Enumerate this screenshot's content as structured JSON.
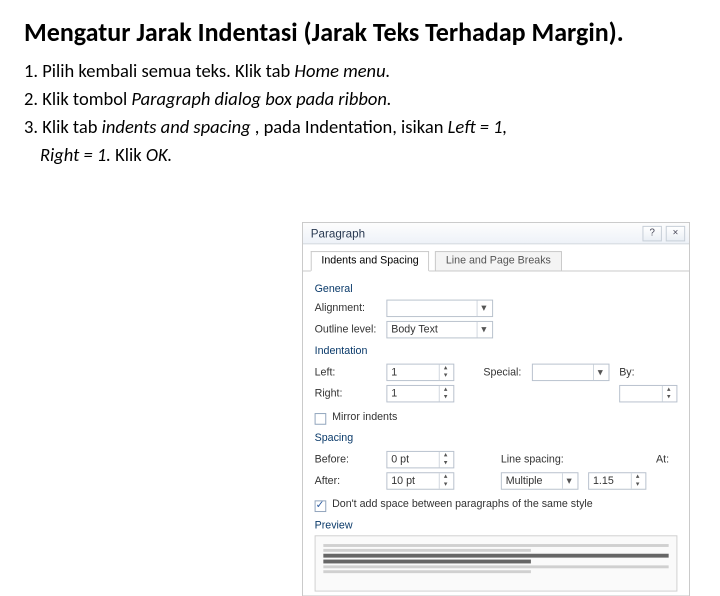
{
  "title": "Mengatur Jarak Indentasi (Jarak Teks Terhadap Margin).",
  "steps": {
    "s1a": "1. Pilih kembali semua teks. Klik tab ",
    "s1b": "Home menu.",
    "s2a": "2. Klik tombol ",
    "s2b": "Paragraph dialog box pada ribbon.",
    "s3a": "3. Klik tab ",
    "s3b": "indents and spacing ",
    "s3c": ", pada Indentation, isikan ",
    "s3d": "Left = 1,",
    "s3e": "Right = 1. ",
    "s3f": "Klik ",
    "s3g": "OK."
  },
  "dialog": {
    "title": "Paragraph",
    "help": "?",
    "close": "×",
    "tabs": {
      "active": "Indents and Spacing",
      "other": "Line and Page Breaks"
    },
    "general": {
      "heading": "General",
      "alignment_lbl": "Alignment:",
      "alignment_val": "",
      "outline_lbl": "Outline level:",
      "outline_val": "Body Text"
    },
    "indent": {
      "heading": "Indentation",
      "left_lbl": "Left:",
      "left_val": "1",
      "right_lbl": "Right:",
      "right_val": "1",
      "special_lbl": "Special:",
      "special_val": "",
      "by_lbl": "By:",
      "by_val": "",
      "mirror": "Mirror indents"
    },
    "spacing": {
      "heading": "Spacing",
      "before_lbl": "Before:",
      "before_val": "0 pt",
      "after_lbl": "After:",
      "after_val": "10 pt",
      "line_lbl": "Line spacing:",
      "line_val": "Multiple",
      "at_lbl": "At:",
      "at_val": "1.15",
      "dont": "Don't add space between paragraphs of the same style"
    },
    "preview_h": "Preview"
  }
}
